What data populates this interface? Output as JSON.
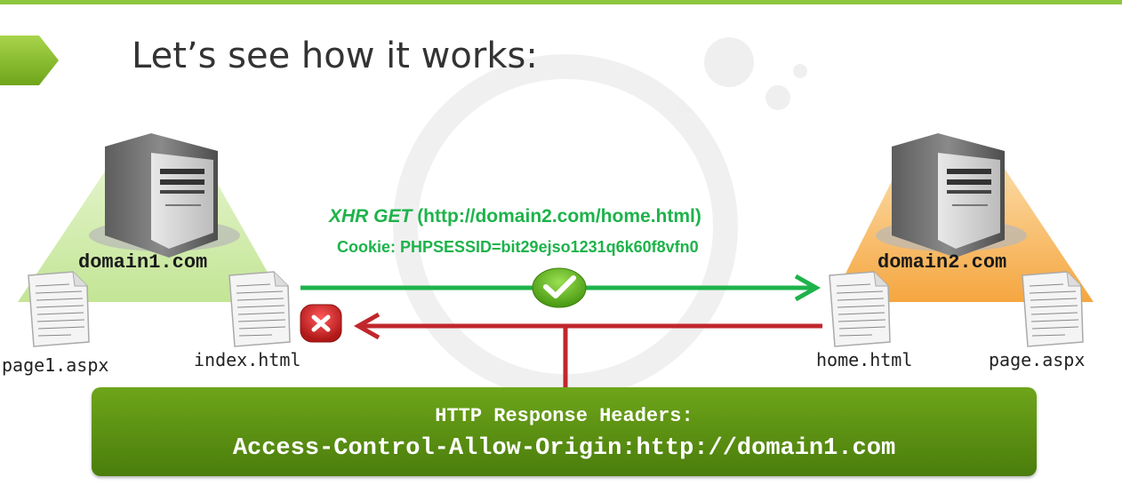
{
  "slide": {
    "title": "Let’s see how it works:"
  },
  "left_server": {
    "domain": "domain1.com",
    "files": [
      "page1.aspx",
      "index.html"
    ]
  },
  "right_server": {
    "domain": "domain2.com",
    "files": [
      "home.html",
      "page.aspx"
    ]
  },
  "request": {
    "method": "XHR GET",
    "url": "(http://domain2.com/home.html)",
    "cookie": "Cookie: PHPSESSID=bit29ejso1231q6k60f8vfn0"
  },
  "response": {
    "header_title": "HTTP Response Headers:",
    "header_value": "Access-Control-Allow-Origin:http://domain1.com"
  },
  "colors": {
    "accent": "#8dc63f",
    "request_arrow": "#1db34a",
    "response_arrow": "#c0272d",
    "box": "#5a8f12"
  }
}
